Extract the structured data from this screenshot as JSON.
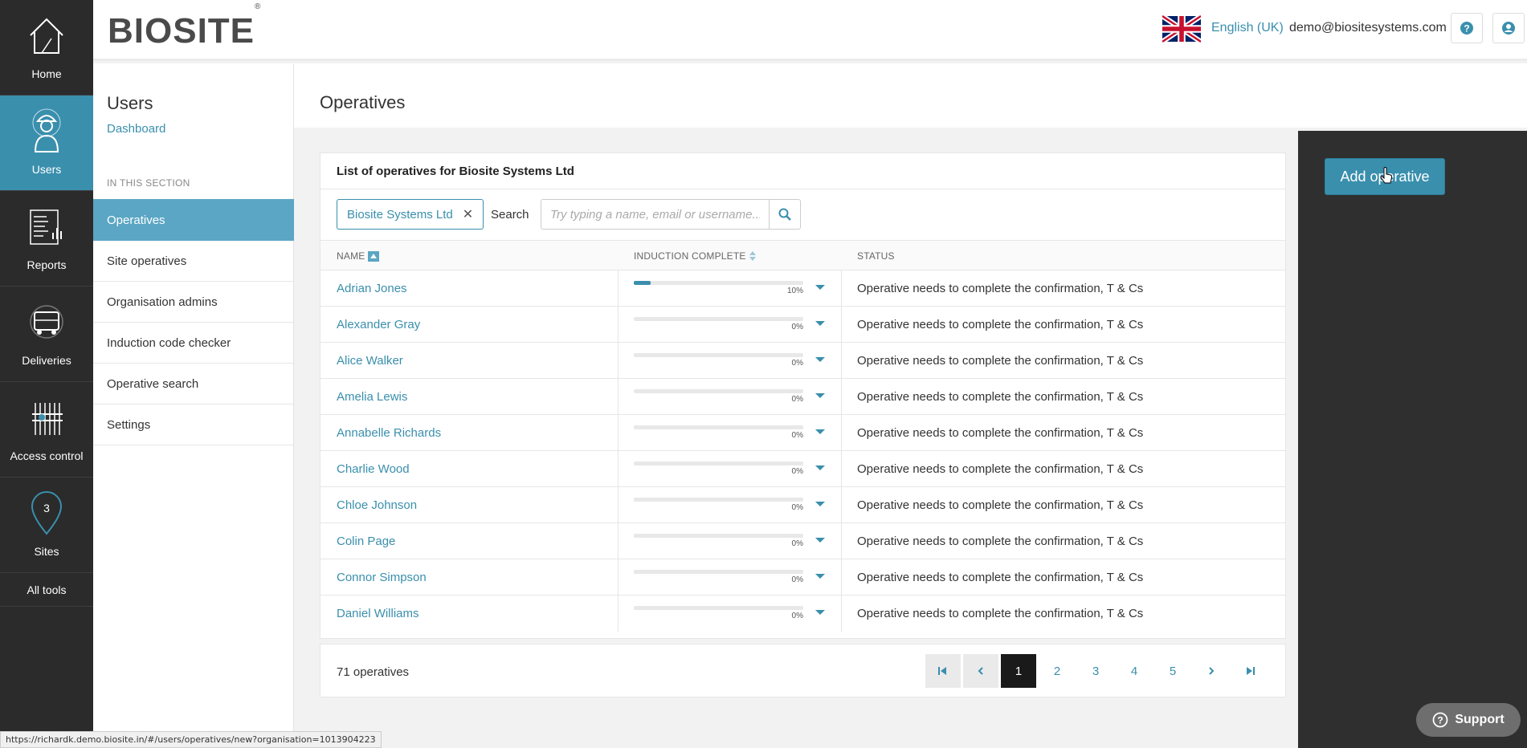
{
  "rail": {
    "items": [
      {
        "label": "Home",
        "icon": "home-icon"
      },
      {
        "label": "Users",
        "icon": "worker-icon"
      },
      {
        "label": "Reports",
        "icon": "reports-icon"
      },
      {
        "label": "Deliveries",
        "icon": "truck-icon"
      },
      {
        "label": "Access control",
        "icon": "access-control-icon"
      },
      {
        "label": "Sites",
        "icon": "map-pin-icon",
        "badge": "3"
      }
    ],
    "all_tools": "All tools"
  },
  "header": {
    "logo": "BIOSITE",
    "logo_mark": "®",
    "language": "English (UK)",
    "email": "demo@biositesystems.com"
  },
  "sidebar": {
    "title": "Users",
    "dashboard_link": "Dashboard",
    "section_label": "IN THIS SECTION",
    "items": [
      {
        "label": "Operatives",
        "active": true
      },
      {
        "label": "Site operatives"
      },
      {
        "label": "Organisation admins"
      },
      {
        "label": "Induction code checker"
      },
      {
        "label": "Operative search"
      },
      {
        "label": "Settings"
      }
    ]
  },
  "main": {
    "title": "Operatives",
    "add_button": "Add operative",
    "card_title": "List of operatives for Biosite Systems Ltd",
    "filter_tag": "Biosite Systems Ltd",
    "search_label": "Search",
    "search_placeholder": "Try typing a name, email or username...",
    "columns": {
      "name": "NAME",
      "induction": "INDUCTION COMPLETE",
      "status": "STATUS"
    },
    "rows": [
      {
        "name": "Adrian Jones",
        "progress": 10,
        "pct_label": "10%",
        "status": "Operative needs to complete the confirmation, T & Cs"
      },
      {
        "name": "Alexander Gray",
        "progress": 0,
        "pct_label": "0%",
        "status": "Operative needs to complete the confirmation, T & Cs"
      },
      {
        "name": "Alice Walker",
        "progress": 0,
        "pct_label": "0%",
        "status": "Operative needs to complete the confirmation, T & Cs"
      },
      {
        "name": "Amelia Lewis",
        "progress": 0,
        "pct_label": "0%",
        "status": "Operative needs to complete the confirmation, T & Cs"
      },
      {
        "name": "Annabelle Richards",
        "progress": 0,
        "pct_label": "0%",
        "status": "Operative needs to complete the confirmation, T & Cs"
      },
      {
        "name": "Charlie Wood",
        "progress": 0,
        "pct_label": "0%",
        "status": "Operative needs to complete the confirmation, T & Cs"
      },
      {
        "name": "Chloe Johnson",
        "progress": 0,
        "pct_label": "0%",
        "status": "Operative needs to complete the confirmation, T & Cs"
      },
      {
        "name": "Colin Page",
        "progress": 0,
        "pct_label": "0%",
        "status": "Operative needs to complete the confirmation, T & Cs"
      },
      {
        "name": "Connor Simpson",
        "progress": 0,
        "pct_label": "0%",
        "status": "Operative needs to complete the confirmation, T & Cs"
      },
      {
        "name": "Daniel Williams",
        "progress": 0,
        "pct_label": "0%",
        "status": "Operative needs to complete the confirmation, T & Cs"
      }
    ],
    "total": "71 operatives",
    "pages": [
      "1",
      "2",
      "3",
      "4",
      "5"
    ],
    "current_page": "1"
  },
  "support": "Support",
  "status_url": "https://richardk.demo.biosite.in/#/users/operatives/new?organisation=1013904223",
  "colors": {
    "accent": "#3a8fad",
    "rail": "#2b2b2b",
    "panel": "#2f2f2f"
  }
}
